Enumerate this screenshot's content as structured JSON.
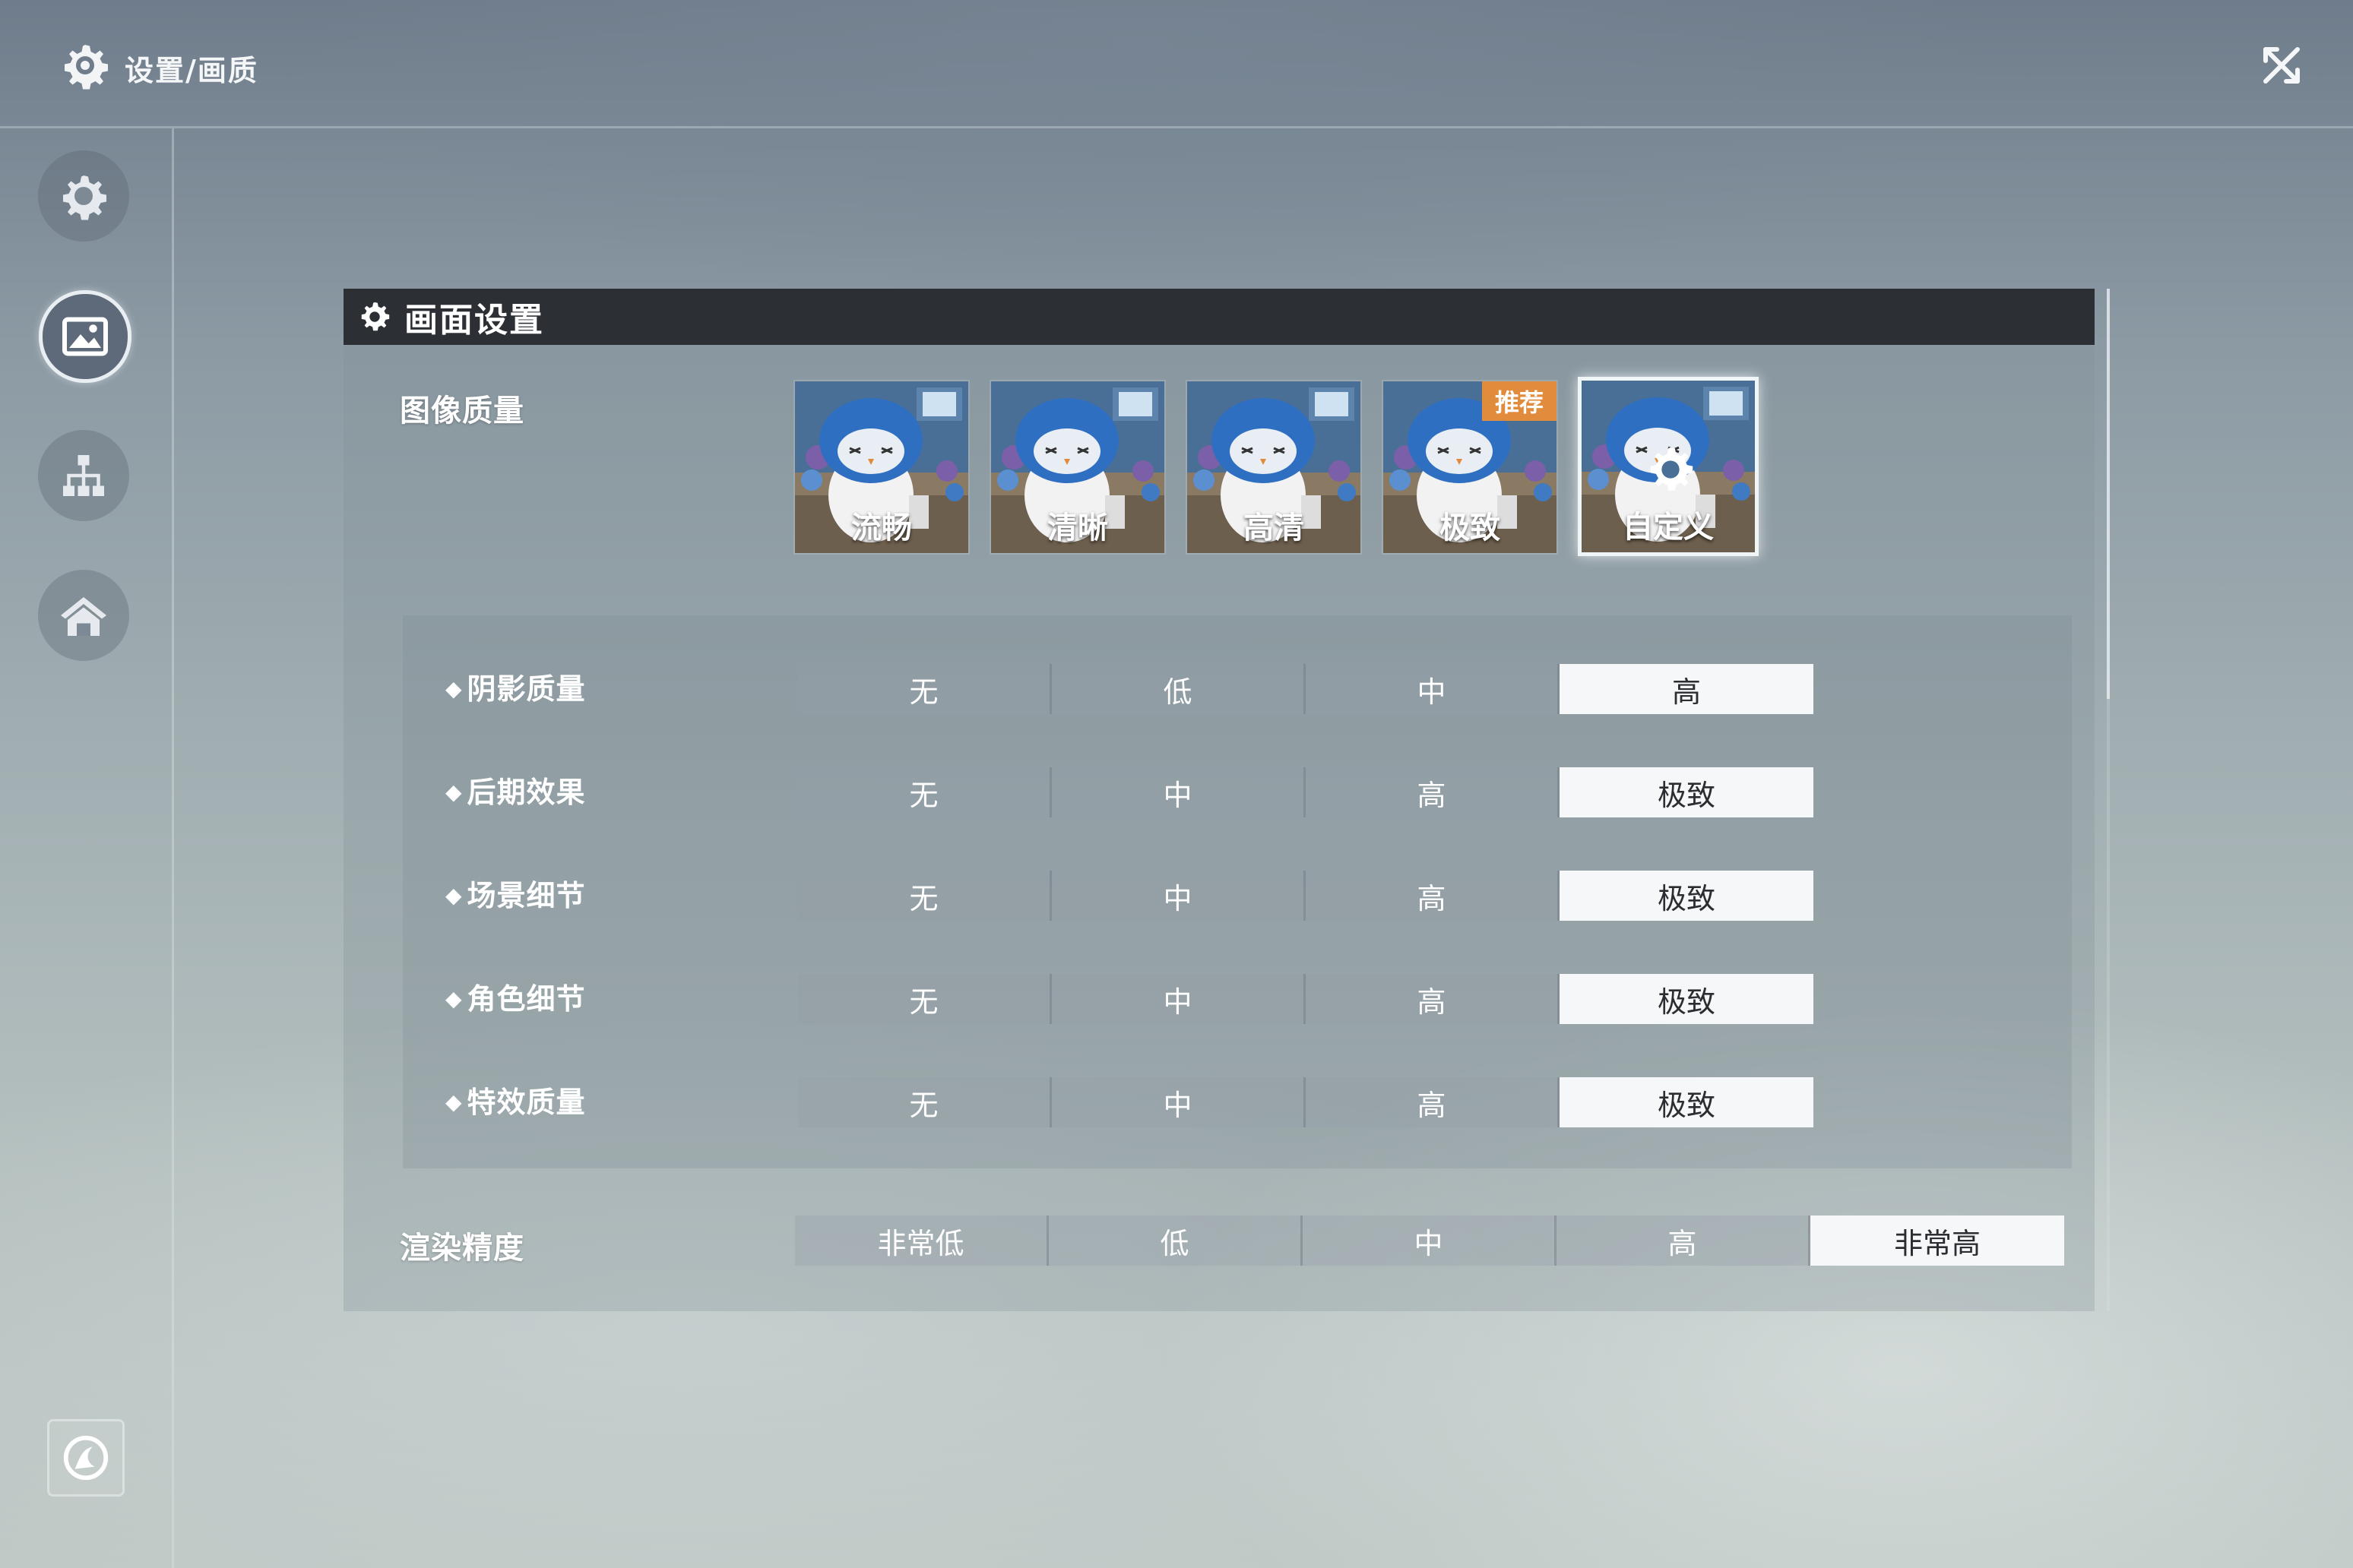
{
  "header": {
    "title": "设置/画质"
  },
  "panel": {
    "title": "画面设置"
  },
  "image_quality": {
    "label": "图像质量",
    "presets": [
      {
        "label": "流畅"
      },
      {
        "label": "清晰"
      },
      {
        "label": "高清"
      },
      {
        "label": "极致",
        "badge": "推荐"
      },
      {
        "label": "自定义",
        "selected": true
      }
    ]
  },
  "settings": [
    {
      "label": "阴影质量",
      "options": [
        "无",
        "低",
        "中",
        "高"
      ],
      "selected": 3
    },
    {
      "label": "后期效果",
      "options": [
        "无",
        "中",
        "高",
        "极致"
      ],
      "selected": 3
    },
    {
      "label": "场景细节",
      "options": [
        "无",
        "中",
        "高",
        "极致"
      ],
      "selected": 3
    },
    {
      "label": "角色细节",
      "options": [
        "无",
        "中",
        "高",
        "极致"
      ],
      "selected": 3
    },
    {
      "label": "特效质量",
      "options": [
        "无",
        "中",
        "高",
        "极致"
      ],
      "selected": 3
    }
  ],
  "render_precision": {
    "label": "渲染精度",
    "options": [
      "非常低",
      "低",
      "中",
      "高",
      "非常高"
    ],
    "selected": 4
  },
  "colors": {
    "accent_badge": "#e18b3c",
    "selected_option_bg": "#f6f7f8",
    "header_bar": "#2c2f34"
  },
  "icons": {
    "header": "settings-gear-icon",
    "close": "close-collapse-icon",
    "nav": [
      "settings-gear-icon",
      "image-icon",
      "network-hierarchy-icon",
      "home-icon"
    ],
    "bottom": "chat-bubble-icon"
  }
}
